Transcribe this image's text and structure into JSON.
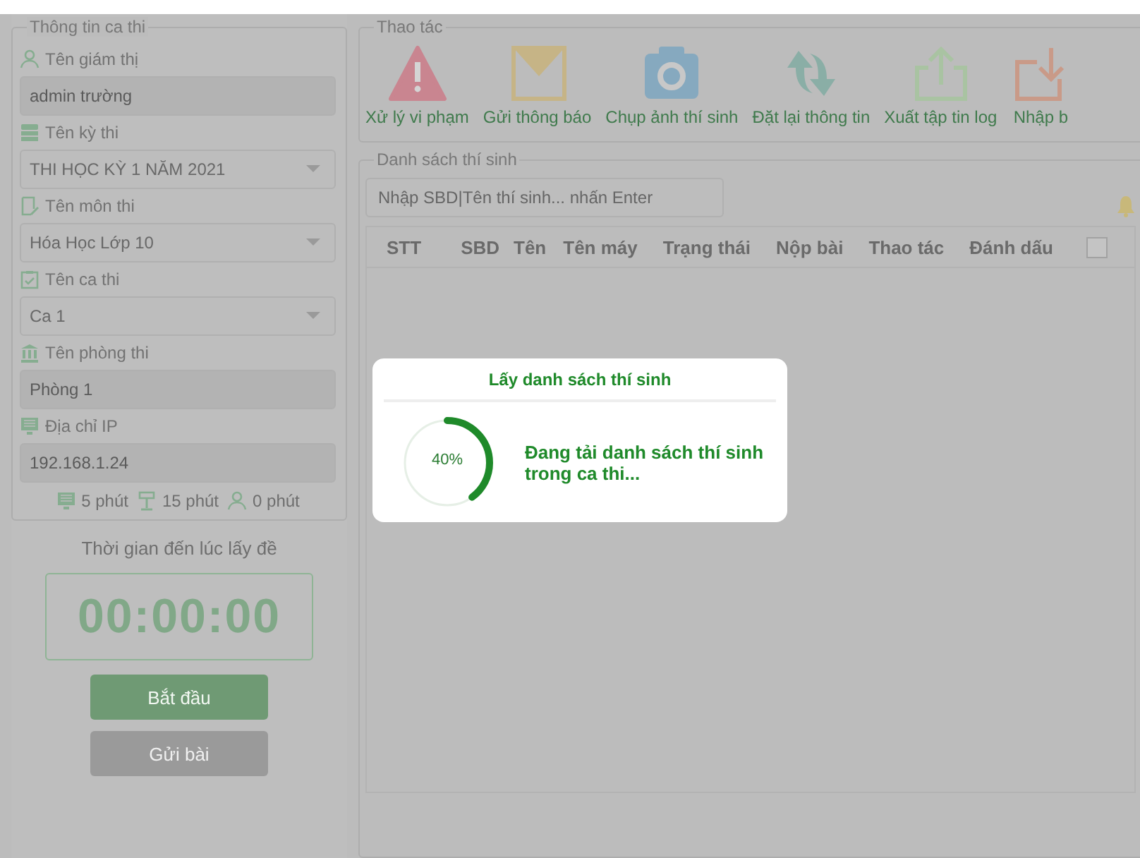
{
  "session_panel": {
    "title": "Thông tin ca thi",
    "fields": [
      {
        "label": "Tên giám thị",
        "kind": "input",
        "value": "admin trường"
      },
      {
        "label": "Tên kỳ thi",
        "kind": "select",
        "value": "THI HỌC KỲ 1 NĂM 2021"
      },
      {
        "label": "Tên môn thi",
        "kind": "select",
        "value": "Hóa Học Lớp 10"
      },
      {
        "label": "Tên ca thi",
        "kind": "select",
        "value": "Ca 1"
      },
      {
        "label": "Tên phòng thi",
        "kind": "input",
        "value": "Phòng 1"
      },
      {
        "label": "Địa chỉ IP",
        "kind": "input",
        "value": "192.168.1.24"
      }
    ],
    "durations": [
      "5 phút",
      "15 phút",
      "0 phút"
    ]
  },
  "countdown": {
    "label": "Thời gian đến lúc lấy đề",
    "time": "00:00:00"
  },
  "buttons": [
    {
      "label": "Bắt đầu",
      "disabled": false
    },
    {
      "label": "Gửi bài",
      "disabled": true
    }
  ],
  "actions": {
    "title": "Thao tác",
    "items": [
      {
        "label": "Xử lý vi phạm",
        "color": "#c98590"
      },
      {
        "label": "Gửi thông báo",
        "color": "#c6b486"
      },
      {
        "label": "Chụp ảnh thí sinh",
        "color": "#86a9bf"
      },
      {
        "label": "Đặt lại thông tin",
        "color": "#8aaea6"
      },
      {
        "label": "Xuất tập tin log",
        "color": "#a9c3a2"
      },
      {
        "label": "Nhập b",
        "color": "#c99a88"
      }
    ]
  },
  "candidates": {
    "title": "Danh sách thí sinh",
    "search": {
      "placeholder": "Nhập SBD|Tên thí sinh... nhấn Enter"
    },
    "columns": [
      "STT",
      "SBD",
      "Tên",
      "Tên máy",
      "Trạng thái",
      "Nộp bài",
      "Thao tác",
      "Đánh dấu"
    ],
    "select_all": {
      "checked": false
    }
  },
  "dialog": {
    "title": "Lấy danh sách thí sinh",
    "message": "Đang tải danh sách thí sinh trong ca thi...",
    "level": 0.4,
    "reading": "40%"
  }
}
